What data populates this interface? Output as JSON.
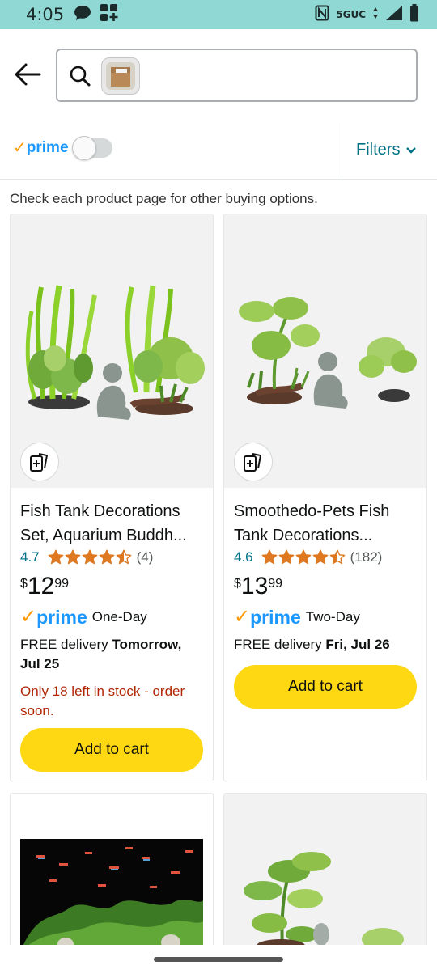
{
  "status_bar": {
    "time": "4:05",
    "network": "5GUC"
  },
  "search": {
    "placeholder": ""
  },
  "filter_bar": {
    "prime_check": "✓",
    "prime_label": "prime",
    "filters_label": "Filters"
  },
  "notice": "Check each product page for other buying options.",
  "products": [
    {
      "title": "Fish Tank Decorations Set, Aquarium Buddh...",
      "rating": "4.7",
      "stars": 4.5,
      "reviews": "(4)",
      "currency": "$",
      "price_whole": "12",
      "price_fraction": "99",
      "prime_check": "✓",
      "prime_word": "prime",
      "delivery_speed": "One-Day",
      "delivery_prefix": "FREE delivery ",
      "delivery_date": "Tomorrow, Jul 25",
      "stock_note": "Only 18 left in stock - order soon.",
      "cart_label": "Add to cart"
    },
    {
      "title": "Smoothedo-Pets Fish Tank Decorations...",
      "rating": "4.6",
      "stars": 4.5,
      "reviews": "(182)",
      "currency": "$",
      "price_whole": "13",
      "price_fraction": "99",
      "prime_check": "✓",
      "prime_word": "prime",
      "delivery_speed": "Two-Day",
      "delivery_prefix": "FREE delivery ",
      "delivery_date": "Fri, Jul 26",
      "stock_note": "",
      "cart_label": "Add to cart"
    }
  ],
  "colors": {
    "accent": "#007185",
    "cart_button": "#ffd814",
    "prime_blue": "#1a98ff",
    "prime_check": "#ff9900",
    "star": "#de7921",
    "stock_red": "#b12704"
  }
}
